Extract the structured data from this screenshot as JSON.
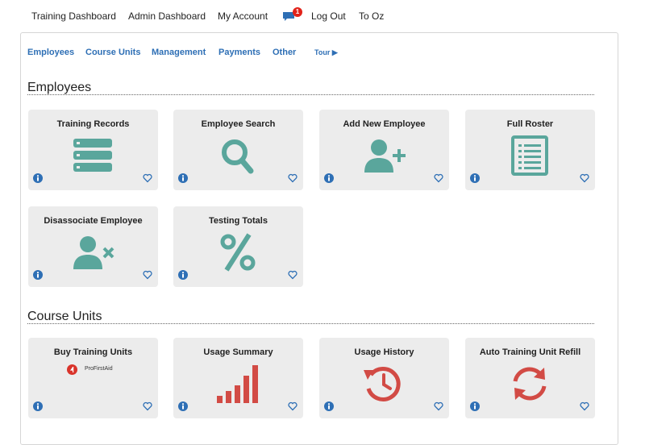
{
  "topnav": {
    "items": [
      "Training Dashboard",
      "Admin Dashboard",
      "My Account",
      "Log Out",
      "To Oz"
    ],
    "notification_count": "1"
  },
  "subnav": {
    "items": [
      "Employees",
      "Course Units",
      "Management",
      "Payments",
      "Other"
    ],
    "tour_label": "Tour ▶"
  },
  "sections": {
    "employees": {
      "title": "Employees",
      "cards": [
        {
          "title": "Training Records",
          "icon": "server-stack-icon"
        },
        {
          "title": "Employee Search",
          "icon": "magnifier-icon"
        },
        {
          "title": "Add New Employee",
          "icon": "user-add-icon"
        },
        {
          "title": "Full Roster",
          "icon": "roster-list-icon"
        },
        {
          "title": "Disassociate Employee",
          "icon": "user-remove-icon"
        },
        {
          "title": "Testing Totals",
          "icon": "percent-icon"
        }
      ]
    },
    "course_units": {
      "title": "Course Units",
      "cards": [
        {
          "title": "Buy Training Units",
          "brand": "ProFirstAid",
          "icon": "profirstaid-logo"
        },
        {
          "title": "Usage Summary",
          "icon": "bar-chart-icon"
        },
        {
          "title": "Usage History",
          "icon": "history-icon"
        },
        {
          "title": "Auto Training Unit Refill",
          "icon": "refresh-icon"
        }
      ]
    }
  },
  "colors": {
    "link": "#2e6fb5",
    "teal_icon": "#5aa69c",
    "red_icon": "#d24b45",
    "card_bg": "#ececec",
    "badge": "#e2231a"
  }
}
